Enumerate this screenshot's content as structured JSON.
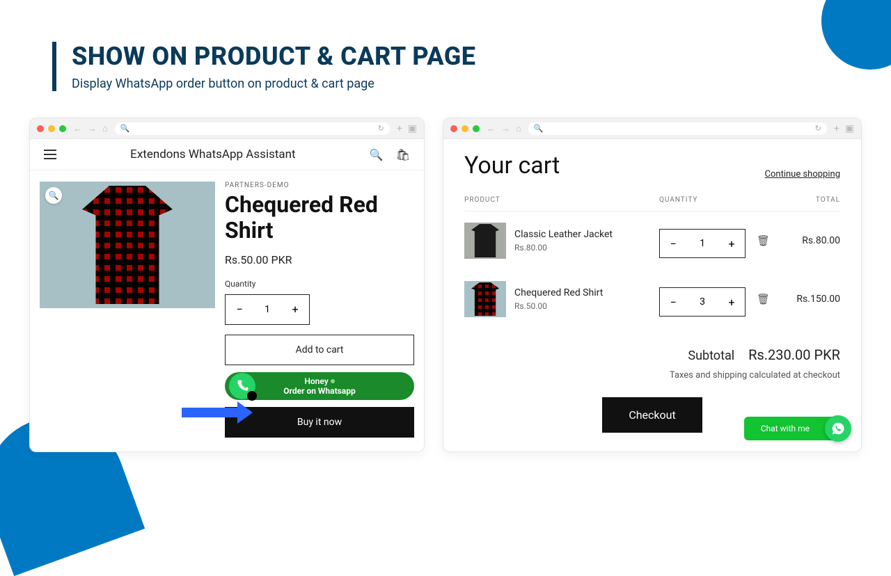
{
  "header": {
    "title": "SHOW ON PRODUCT & CART PAGE",
    "subtitle": "Display WhatsApp order button on product & cart page"
  },
  "colors": {
    "accent": "#0b3a5a",
    "whatsapp": "#1a8a2b",
    "arrow": "#2b63ff"
  },
  "product_panel": {
    "store_name": "Extendons WhatsApp Assistant",
    "brand": "PARTNERS-DEMO",
    "title": "Chequered Red Shirt",
    "price": "Rs.50.00 PKR",
    "quantity_label": "Quantity",
    "quantity": "1",
    "add_to_cart": "Add to cart",
    "whatsapp_line1": "Honey",
    "whatsapp_line2": "Order on Whatsapp",
    "buy_now": "Buy it now"
  },
  "cart_panel": {
    "title": "Your cart",
    "continue": "Continue shopping",
    "cols": {
      "product": "PRODUCT",
      "quantity": "QUANTITY",
      "total": "TOTAL"
    },
    "items": [
      {
        "name": "Classic Leather Jacket",
        "price": "Rs.80.00",
        "qty": "1",
        "total": "Rs.80.00"
      },
      {
        "name": "Chequered Red Shirt",
        "price": "Rs.50.00",
        "qty": "3",
        "total": "Rs.150.00"
      }
    ],
    "subtotal_label": "Subtotal",
    "subtotal_value": "Rs.230.00 PKR",
    "note": "Taxes and shipping calculated at checkout",
    "checkout": "Checkout",
    "chat": "Chat with me"
  }
}
